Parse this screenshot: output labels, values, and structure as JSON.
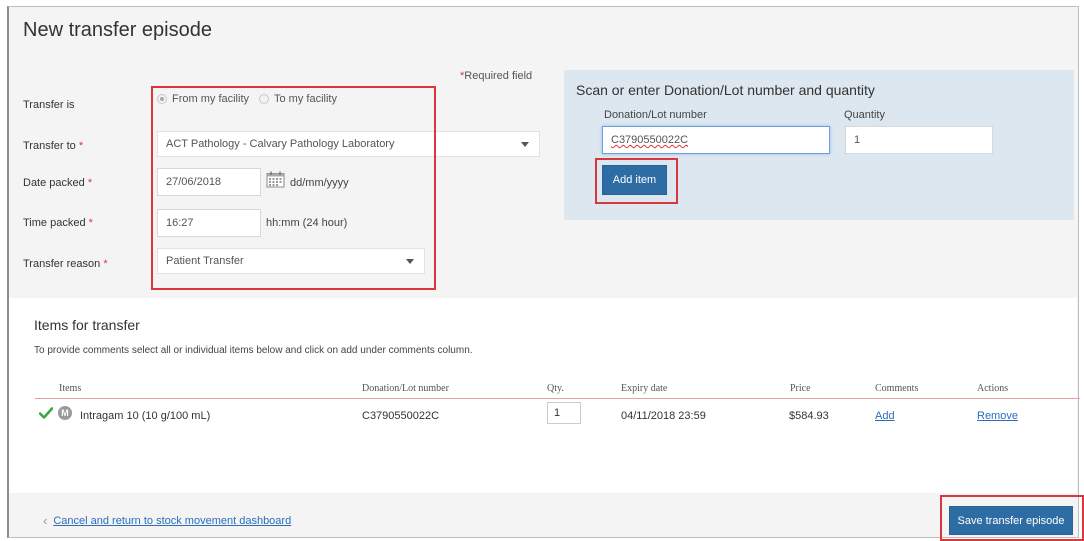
{
  "page_title": "New transfer episode",
  "required_note": "Required field",
  "form": {
    "transfer_is_label": "Transfer is",
    "radio_from": "From my facility",
    "radio_to": "To my facility",
    "transfer_to_label": "Transfer to",
    "transfer_to_value": "ACT Pathology - Calvary Pathology Laboratory",
    "date_packed_label": "Date packed",
    "date_packed_value": "27/06/2018",
    "date_format_hint": "dd/mm/yyyy",
    "time_packed_label": "Time packed",
    "time_packed_value": "16:27",
    "time_format_hint": "hh:mm (24 hour)",
    "transfer_reason_label": "Transfer reason",
    "transfer_reason_value": "Patient Transfer",
    "required_star": "*"
  },
  "scan": {
    "title": "Scan or enter Donation/Lot number and quantity",
    "donation_label": "Donation/Lot number",
    "donation_value": "C3790550022C",
    "quantity_label": "Quantity",
    "quantity_value": "1",
    "add_item_label": "Add item"
  },
  "items": {
    "title": "Items for transfer",
    "note": "To provide comments select all or individual items below and click on add under comments column.",
    "columns": [
      "Items",
      "Donation/Lot number",
      "Qty.",
      "Expiry date",
      "Price",
      "Comments",
      "Actions"
    ],
    "rows": [
      {
        "badge": "M",
        "item": "Intragam 10 (10 g/100 mL)",
        "lot": "C3790550022C",
        "qty": "1",
        "expiry": "04/11/2018 23:59",
        "price": "$584.93",
        "comments": "Add",
        "action": "Remove"
      }
    ]
  },
  "footer": {
    "cancel_label": "Cancel and return to stock movement dashboard",
    "save_label": "Save transfer episode"
  },
  "colors": {
    "highlight_red": "#d9373e",
    "primary_blue": "#2e6da4",
    "panel_blue": "#dde7f0",
    "check_green": "#3aa845"
  }
}
